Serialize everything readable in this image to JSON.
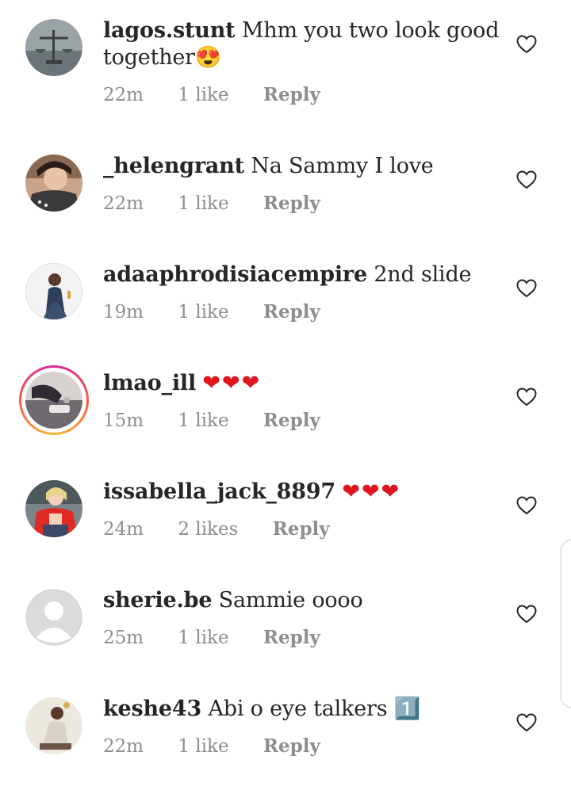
{
  "comments": [
    {
      "username": "lagos.stunt",
      "text": "Mhm you two look good together😍",
      "time": "22m",
      "likes": "1 like",
      "reply": "Reply"
    },
    {
      "username": "_helengrant",
      "text": "Na Sammy I love",
      "time": "22m",
      "likes": "1 like",
      "reply": "Reply"
    },
    {
      "username": "adaaphrodisiacempire",
      "text": "2nd slide",
      "time": "19m",
      "likes": "1 like",
      "reply": "Reply"
    },
    {
      "username": "lmao_ill",
      "text": "❤❤❤",
      "time": "15m",
      "likes": "1 like",
      "reply": "Reply"
    },
    {
      "username": "issabella_jack_8897",
      "text": "❤❤❤",
      "time": "24m",
      "likes": "2 likes",
      "reply": "Reply"
    },
    {
      "username": "sherie.be",
      "text": "Sammie oooo",
      "time": "25m",
      "likes": "1 like",
      "reply": "Reply"
    },
    {
      "username": "keshe43",
      "text": "Abi o eye talkers 1️⃣",
      "time": "22m",
      "likes": "1 like",
      "reply": "Reply"
    }
  ],
  "icons": {
    "like": "heart-outline-icon",
    "avatar_placeholder": "default-avatar-icon"
  },
  "colors": {
    "text": "#262626",
    "meta": "#8e8e8e",
    "heart_emoji": "#e0151d",
    "story_ring": "#fd5949"
  }
}
